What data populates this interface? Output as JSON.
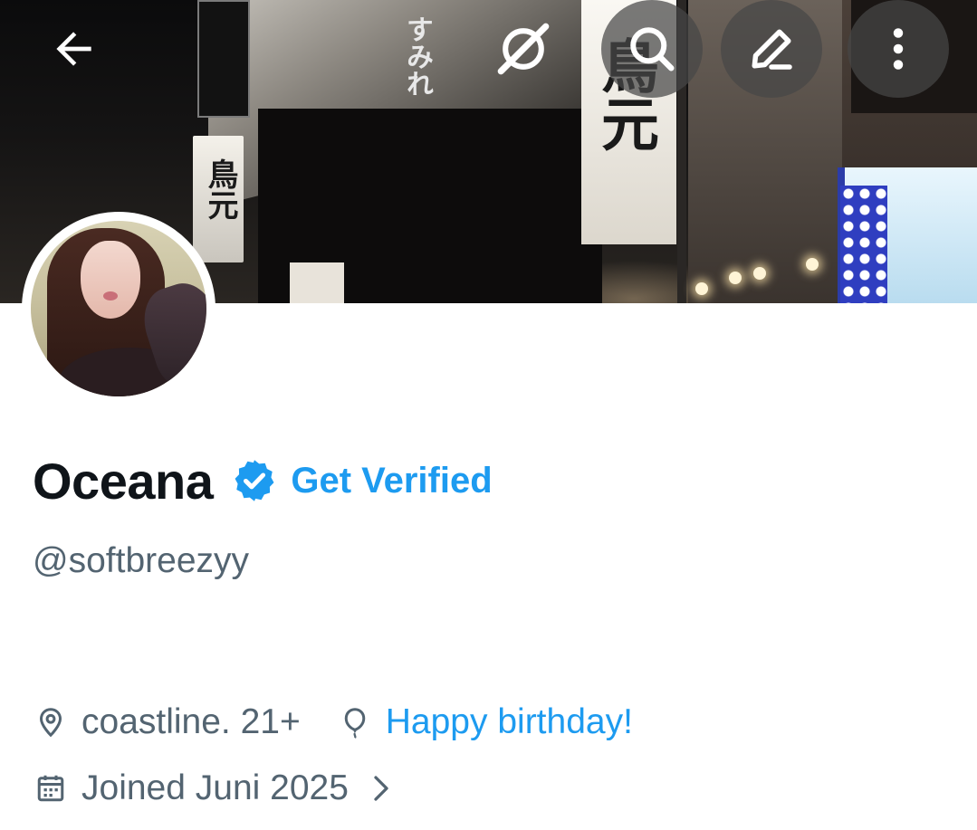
{
  "header": {
    "back_icon": "arrow-left-icon",
    "actions": [
      {
        "name": "grok-icon"
      },
      {
        "name": "search-icon"
      },
      {
        "name": "edit-icon"
      },
      {
        "name": "more-vertical-icon"
      }
    ]
  },
  "banner": {
    "signs": [
      "すみれ",
      "鳥元",
      "鳥元"
    ]
  },
  "profile": {
    "display_name": "Oceana",
    "verified_icon": "verified-badge-icon",
    "get_verified_label": "Get Verified",
    "handle": "@softbreezyy",
    "location": "coastline. 21+",
    "birthday": "Happy birthday!",
    "joined": "Joined Juni 2025"
  },
  "colors": {
    "accent": "#1d9bf0",
    "secondary_text": "#536471",
    "primary_text": "#0f1419"
  }
}
